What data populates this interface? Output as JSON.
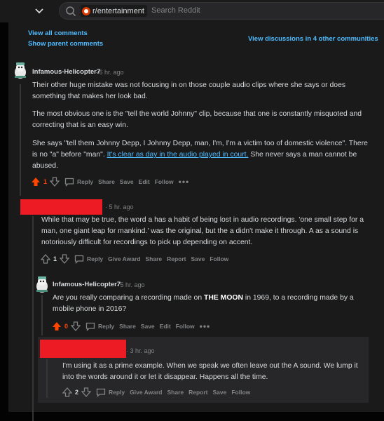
{
  "header": {
    "subreddit": "r/entertainment",
    "search_placeholder": "Search Reddit"
  },
  "links": {
    "view_all": "View all comments",
    "show_parent": "Show parent comments",
    "view_discussions": "View discussions in 4 other communities"
  },
  "comments": [
    {
      "author": "Infamous-Helicopter7",
      "time": "6 hr. ago",
      "paragraphs": [
        "Their other huge mistake was not focusing in on those couple audio clips where she says or does something that makes her look bad.",
        "The most obvious one is the \"tell the world Johnny\" clip, because that one is constantly misquoted and correcting that is an easy win."
      ],
      "p3_before": "She says \"tell them Johnny Depp, I Johnny Depp, man, I'm, I'm a victim too of domestic violence\". There is no \"a\" before \"man\". ",
      "p3_link": "It's clear as day in the audio played in court.",
      "p3_after": " She never says a man cannot be abused.",
      "votes": "1",
      "actions": [
        "Reply",
        "Share",
        "Save",
        "Edit",
        "Follow"
      ]
    },
    {
      "author": "",
      "time": "5 hr. ago",
      "text": "While that may be true, the word a has a habit of being lost in audio recordings. 'one small step for a man, one giant leap for mankind.' was the original, but the a didn't make it through. A as a sound is notoriously difficult for recordings to pick up depending on accent.",
      "votes": "1",
      "actions": [
        "Reply",
        "Give Award",
        "Share",
        "Report",
        "Save",
        "Follow"
      ]
    },
    {
      "author": "Infamous-Helicopter7",
      "time": "5 hr. ago",
      "text_before": "Are you really comparing a recording made on ",
      "text_bold": "THE MOON",
      "text_after": " in 1969, to a recording made by a mobile phone in 2016?",
      "votes": "0",
      "actions": [
        "Reply",
        "Share",
        "Save",
        "Edit",
        "Follow"
      ]
    },
    {
      "author": "",
      "time": "3 hr. ago",
      "text": "I'm using it as a prime example. When we speak we often leave out the A sound. We lump it into the words around it or let it disappear. Happens all the time.",
      "votes": "2",
      "actions": [
        "Reply",
        "Give Award",
        "Share",
        "Report",
        "Save",
        "Follow"
      ]
    }
  ],
  "more_icon": "ellipsis-icon",
  "colors": {
    "accent": "#4fbcff",
    "upvote": "#ff4500",
    "redaction": "#ed1c24"
  }
}
